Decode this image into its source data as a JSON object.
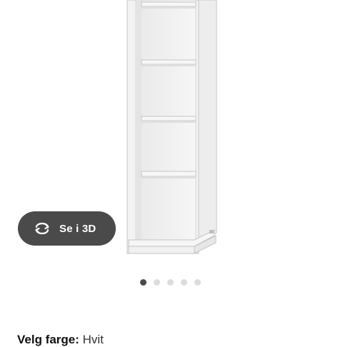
{
  "viewer": {
    "view_3d_label": "Se i 3D",
    "view_3d_icon": "rotate-3d-icon",
    "carousel": {
      "count": 5,
      "active_index": 0
    }
  },
  "product": {
    "color_label": "Velg farge:",
    "color_value": "Hvit"
  },
  "colors": {
    "button_bg": "#4a4a4a",
    "dot_active": "#4a4a4a",
    "dot_inactive": "#dcdcdc",
    "shelf_white": "#f4f4f4"
  }
}
